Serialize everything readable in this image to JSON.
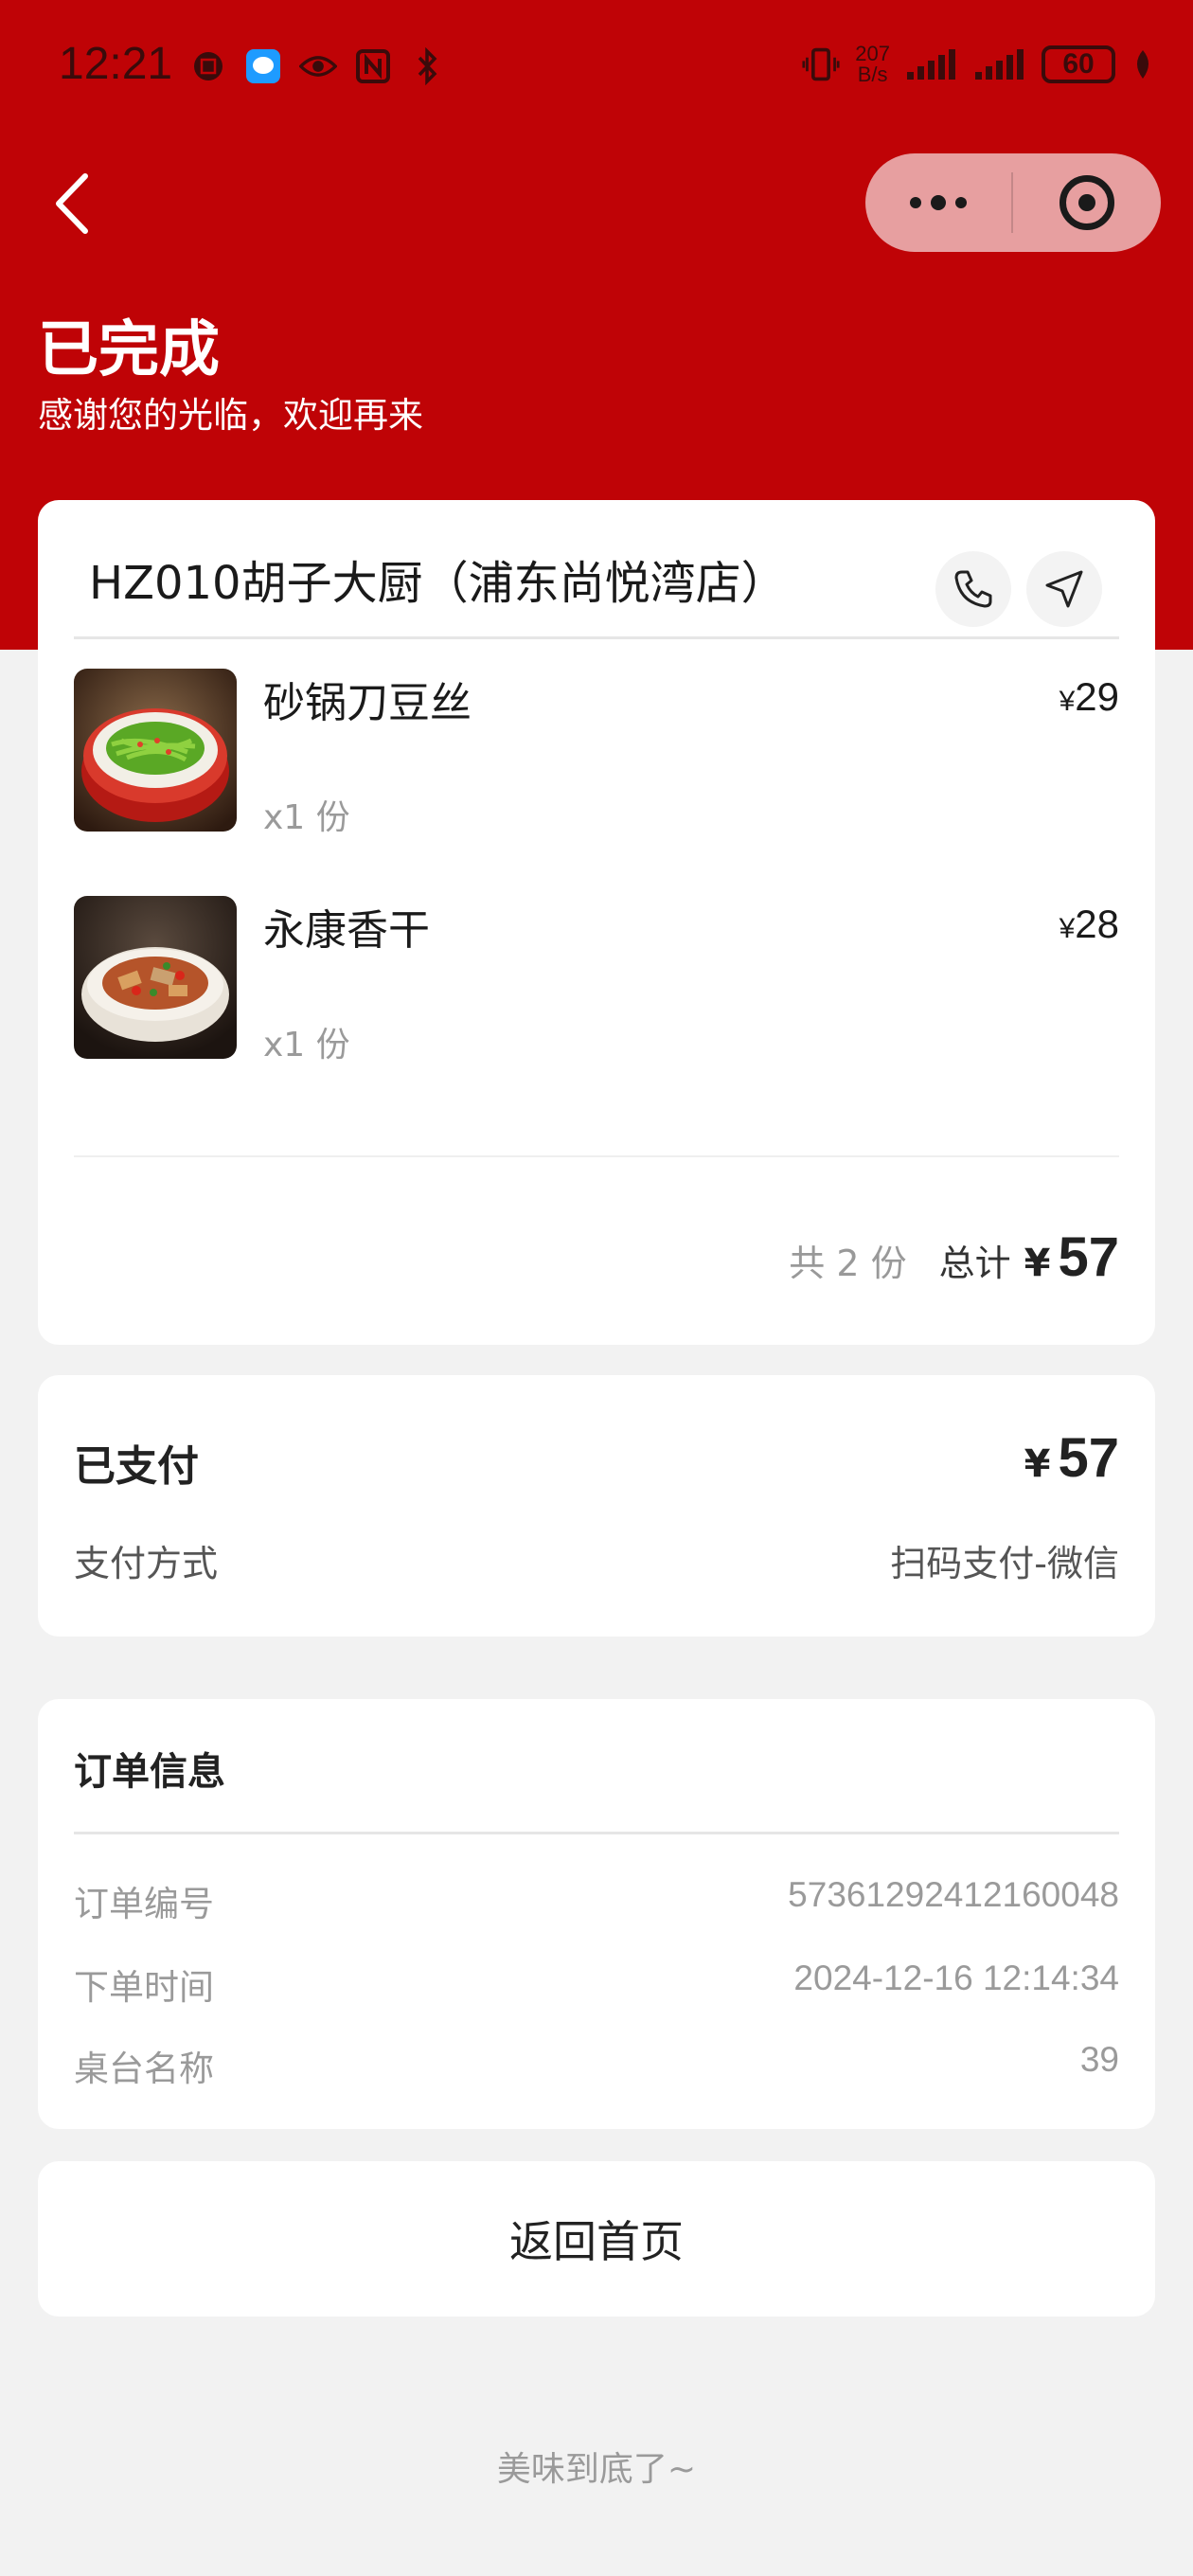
{
  "status_bar": {
    "time": "12:21",
    "net_speed_value": "207",
    "net_speed_unit": "B/s",
    "battery": "60"
  },
  "header": {
    "status_title": "已完成",
    "status_subtitle": "感谢您的光临，欢迎再来"
  },
  "store": {
    "name": "HZ010胡子大厨（浦东尚悦湾店）",
    "items": [
      {
        "name": "砂锅刀豆丝",
        "qty": "x1 份",
        "currency": "¥",
        "price": "29"
      },
      {
        "name": "永康香干",
        "qty": "x1 份",
        "currency": "¥",
        "price": "28"
      }
    ],
    "summary": {
      "count": "共 2 份",
      "total_label": "总计",
      "currency": "¥",
      "total": "57"
    }
  },
  "payment": {
    "paid_label": "已支付",
    "currency": "¥",
    "amount": "57",
    "method_label": "支付方式",
    "method_value": "扫码支付-微信"
  },
  "order_info": {
    "title": "订单信息",
    "rows": [
      {
        "label": "订单编号",
        "value": "57361292412160048"
      },
      {
        "label": "下单时间",
        "value": "2024-12-16 12:14:34"
      },
      {
        "label": "桌台名称",
        "value": "39"
      }
    ]
  },
  "home_button_label": "返回首页",
  "footer": "美味到底了~",
  "colors": {
    "header_red": "#bf0306",
    "background": "#f2f2f2",
    "card": "#ffffff"
  }
}
